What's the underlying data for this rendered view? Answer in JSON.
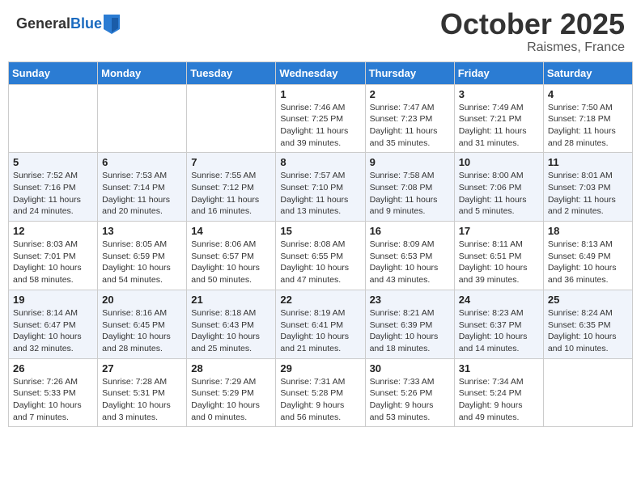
{
  "header": {
    "logo_general": "General",
    "logo_blue": "Blue",
    "month": "October 2025",
    "location": "Raismes, France"
  },
  "weekdays": [
    "Sunday",
    "Monday",
    "Tuesday",
    "Wednesday",
    "Thursday",
    "Friday",
    "Saturday"
  ],
  "weeks": [
    [
      {
        "day": "",
        "info": ""
      },
      {
        "day": "",
        "info": ""
      },
      {
        "day": "",
        "info": ""
      },
      {
        "day": "1",
        "info": "Sunrise: 7:46 AM\nSunset: 7:25 PM\nDaylight: 11 hours and 39 minutes."
      },
      {
        "day": "2",
        "info": "Sunrise: 7:47 AM\nSunset: 7:23 PM\nDaylight: 11 hours and 35 minutes."
      },
      {
        "day": "3",
        "info": "Sunrise: 7:49 AM\nSunset: 7:21 PM\nDaylight: 11 hours and 31 minutes."
      },
      {
        "day": "4",
        "info": "Sunrise: 7:50 AM\nSunset: 7:18 PM\nDaylight: 11 hours and 28 minutes."
      }
    ],
    [
      {
        "day": "5",
        "info": "Sunrise: 7:52 AM\nSunset: 7:16 PM\nDaylight: 11 hours and 24 minutes."
      },
      {
        "day": "6",
        "info": "Sunrise: 7:53 AM\nSunset: 7:14 PM\nDaylight: 11 hours and 20 minutes."
      },
      {
        "day": "7",
        "info": "Sunrise: 7:55 AM\nSunset: 7:12 PM\nDaylight: 11 hours and 16 minutes."
      },
      {
        "day": "8",
        "info": "Sunrise: 7:57 AM\nSunset: 7:10 PM\nDaylight: 11 hours and 13 minutes."
      },
      {
        "day": "9",
        "info": "Sunrise: 7:58 AM\nSunset: 7:08 PM\nDaylight: 11 hours and 9 minutes."
      },
      {
        "day": "10",
        "info": "Sunrise: 8:00 AM\nSunset: 7:06 PM\nDaylight: 11 hours and 5 minutes."
      },
      {
        "day": "11",
        "info": "Sunrise: 8:01 AM\nSunset: 7:03 PM\nDaylight: 11 hours and 2 minutes."
      }
    ],
    [
      {
        "day": "12",
        "info": "Sunrise: 8:03 AM\nSunset: 7:01 PM\nDaylight: 10 hours and 58 minutes."
      },
      {
        "day": "13",
        "info": "Sunrise: 8:05 AM\nSunset: 6:59 PM\nDaylight: 10 hours and 54 minutes."
      },
      {
        "day": "14",
        "info": "Sunrise: 8:06 AM\nSunset: 6:57 PM\nDaylight: 10 hours and 50 minutes."
      },
      {
        "day": "15",
        "info": "Sunrise: 8:08 AM\nSunset: 6:55 PM\nDaylight: 10 hours and 47 minutes."
      },
      {
        "day": "16",
        "info": "Sunrise: 8:09 AM\nSunset: 6:53 PM\nDaylight: 10 hours and 43 minutes."
      },
      {
        "day": "17",
        "info": "Sunrise: 8:11 AM\nSunset: 6:51 PM\nDaylight: 10 hours and 39 minutes."
      },
      {
        "day": "18",
        "info": "Sunrise: 8:13 AM\nSunset: 6:49 PM\nDaylight: 10 hours and 36 minutes."
      }
    ],
    [
      {
        "day": "19",
        "info": "Sunrise: 8:14 AM\nSunset: 6:47 PM\nDaylight: 10 hours and 32 minutes."
      },
      {
        "day": "20",
        "info": "Sunrise: 8:16 AM\nSunset: 6:45 PM\nDaylight: 10 hours and 28 minutes."
      },
      {
        "day": "21",
        "info": "Sunrise: 8:18 AM\nSunset: 6:43 PM\nDaylight: 10 hours and 25 minutes."
      },
      {
        "day": "22",
        "info": "Sunrise: 8:19 AM\nSunset: 6:41 PM\nDaylight: 10 hours and 21 minutes."
      },
      {
        "day": "23",
        "info": "Sunrise: 8:21 AM\nSunset: 6:39 PM\nDaylight: 10 hours and 18 minutes."
      },
      {
        "day": "24",
        "info": "Sunrise: 8:23 AM\nSunset: 6:37 PM\nDaylight: 10 hours and 14 minutes."
      },
      {
        "day": "25",
        "info": "Sunrise: 8:24 AM\nSunset: 6:35 PM\nDaylight: 10 hours and 10 minutes."
      }
    ],
    [
      {
        "day": "26",
        "info": "Sunrise: 7:26 AM\nSunset: 5:33 PM\nDaylight: 10 hours and 7 minutes."
      },
      {
        "day": "27",
        "info": "Sunrise: 7:28 AM\nSunset: 5:31 PM\nDaylight: 10 hours and 3 minutes."
      },
      {
        "day": "28",
        "info": "Sunrise: 7:29 AM\nSunset: 5:29 PM\nDaylight: 10 hours and 0 minutes."
      },
      {
        "day": "29",
        "info": "Sunrise: 7:31 AM\nSunset: 5:28 PM\nDaylight: 9 hours and 56 minutes."
      },
      {
        "day": "30",
        "info": "Sunrise: 7:33 AM\nSunset: 5:26 PM\nDaylight: 9 hours and 53 minutes."
      },
      {
        "day": "31",
        "info": "Sunrise: 7:34 AM\nSunset: 5:24 PM\nDaylight: 9 hours and 49 minutes."
      },
      {
        "day": "",
        "info": ""
      }
    ]
  ]
}
